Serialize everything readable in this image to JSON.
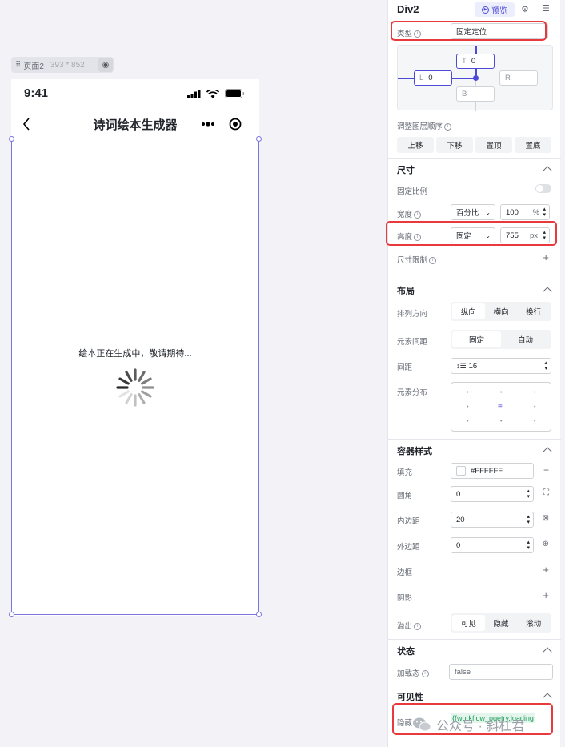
{
  "canvas": {
    "page_tag": {
      "name": "页面2",
      "size": "393 * 852"
    },
    "phone": {
      "status_time": "9:41",
      "nav_title": "诗词绘本生成器",
      "loading_text": "绘本正在生成中，敬请期待..."
    }
  },
  "panel": {
    "title": "Div2",
    "preview_label": "预览",
    "type_label": "类型",
    "type_value": "固定定位",
    "pos": {
      "t": "T",
      "t_value": "0",
      "l": "L",
      "l_value": "0",
      "r": "R",
      "b": "B"
    },
    "layer_label": "调整图层顺序",
    "layer_buttons": [
      "上移",
      "下移",
      "置顶",
      "置底"
    ],
    "size": {
      "title": "尺寸",
      "ratio_label": "固定比例",
      "width_label": "宽度",
      "width_mode": "百分比",
      "width_value": "100",
      "width_unit": "%",
      "height_label": "高度",
      "height_mode": "固定",
      "height_value": "755",
      "height_unit": "px",
      "limit_label": "尺寸限制"
    },
    "layout": {
      "title": "布局",
      "direction_label": "排列方向",
      "direction_options": [
        "纵向",
        "横向",
        "换行"
      ],
      "gap_mode_label": "元素间距",
      "gap_mode_options": [
        "固定",
        "自动"
      ],
      "gap_label": "间距",
      "gap_value": "16",
      "distribution_label": "元素分布"
    },
    "container": {
      "title": "容器样式",
      "fill_label": "填充",
      "fill_value": "#FFFFFF",
      "radius_label": "圆角",
      "radius_value": "0",
      "padding_label": "内边距",
      "padding_value": "20",
      "margin_label": "外边距",
      "margin_value": "0",
      "border_label": "边框",
      "shadow_label": "阴影",
      "overflow_label": "溢出",
      "overflow_options": [
        "可见",
        "隐藏",
        "滚动"
      ]
    },
    "state": {
      "title": "状态",
      "loading_label": "加载态",
      "loading_value": "false"
    },
    "visibility": {
      "title": "可见性",
      "hide_label": "隐藏",
      "hide_value": "{{workflow_poetry.loading"
    }
  },
  "watermark": {
    "text": "公众号 · 斜杠君"
  },
  "colors": {
    "accent": "#4e4ad8",
    "highlight": "#e8393d",
    "selection": "#7b75e0"
  }
}
